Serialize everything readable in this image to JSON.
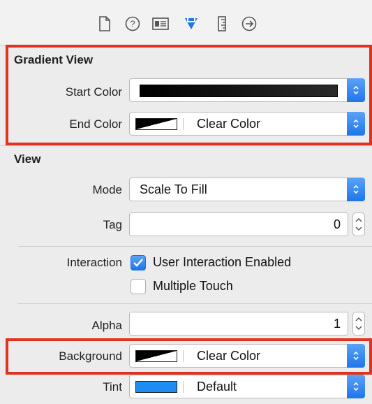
{
  "toolbar": {
    "icons": [
      "file-inspector-icon",
      "quick-help-icon",
      "identity-inspector-icon",
      "attributes-inspector-icon",
      "size-inspector-icon",
      "connections-inspector-icon"
    ],
    "active_color": "#1f76ea"
  },
  "gradient_view": {
    "title": "Gradient View",
    "start_color_label": "Start Color",
    "end_color_label": "End Color",
    "end_color_value": "Clear Color"
  },
  "view": {
    "title": "View",
    "mode_label": "Mode",
    "mode_value": "Scale To Fill",
    "tag_label": "Tag",
    "tag_value": "0",
    "interaction_label": "Interaction",
    "user_interaction_label": "User Interaction Enabled",
    "user_interaction_checked": true,
    "multiple_touch_label": "Multiple Touch",
    "multiple_touch_checked": false,
    "alpha_label": "Alpha",
    "alpha_value": "1",
    "background_label": "Background",
    "background_value": "Clear Color",
    "tint_label": "Tint",
    "tint_value": "Default",
    "tint_color": "#1e8cf0"
  },
  "highlight_color": "#e0321e"
}
